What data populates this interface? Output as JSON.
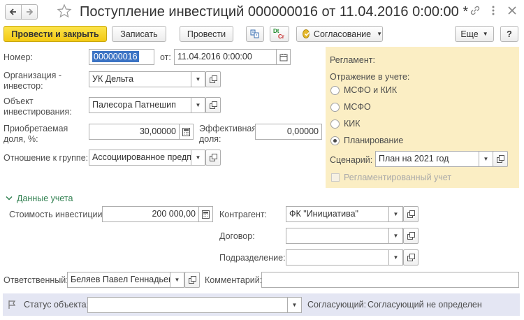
{
  "header": {
    "title": "Поступление инвестиций 000000016 от 11.04.2016 0:00:00 *",
    "back_icon": "arrow-left-icon",
    "forward_icon": "arrow-right-icon",
    "star_icon": "star-icon"
  },
  "toolbar": {
    "post_and_close": "Провести и закрыть",
    "write": "Записать",
    "post": "Провести",
    "dtkt_dt": "Dt",
    "dtkt_kt": "Cr",
    "approval": "Согласование",
    "more": "Еще",
    "help": "?"
  },
  "form": {
    "number_label": "Номер:",
    "number_value": "000000016",
    "date_label": "от:",
    "date_value": "11.04.2016  0:00:00",
    "org_label_1": "Организация -",
    "org_label_2": "инвестор:",
    "org_value": "УК Дельта",
    "object_label_1": "Объект",
    "object_label_2": "инвестирования:",
    "object_value": "Палесора Патнешип",
    "share_label_1": "Приобретаемая",
    "share_label_2": "доля, %:",
    "share_value": "30,00000",
    "eff_label_1": "Эффективная",
    "eff_label_2": "доля:",
    "eff_value": "0,00000",
    "relation_label": "Отношение к группе:",
    "relation_value": "Ассоциированное предпр"
  },
  "regulation": {
    "title": "Регламент:",
    "reflection_label": "Отражение в учете:",
    "options": [
      "МСФО и КИК",
      "МСФО",
      "КИК",
      "Планирование"
    ],
    "selected_index": 3,
    "scenario_label": "Сценарий:",
    "scenario_value": "План на 2021 год",
    "regulated_label": "Регламентированный учет",
    "regulated_checked": false
  },
  "data_section": {
    "title": "Данные учета",
    "cost_label": "Стоимость инвестиции:",
    "cost_value": "200 000,00",
    "counterparty_label": "Контрагент:",
    "counterparty_value": "ФК \"Инициатива\"",
    "contract_label": "Договор:",
    "contract_value": "",
    "division_label": "Подразделение:",
    "division_value": ""
  },
  "footer": {
    "responsible_label": "Ответственный:",
    "responsible_value": "Беляев Павел Геннадьеви",
    "comment_label": "Комментарий:",
    "comment_value": ""
  },
  "status_bar": {
    "status_label": "Статус объекта:",
    "status_value": "",
    "approver_label": "Согласующий:",
    "approver_value": "Согласующий не определен"
  },
  "colors": {
    "accent_yellow": "#f5d02c",
    "regulation_bg": "#fbeec4",
    "status_bg": "#e4e6f3",
    "section_green": "#2f7f4f",
    "selection_blue": "#3b73c4"
  }
}
